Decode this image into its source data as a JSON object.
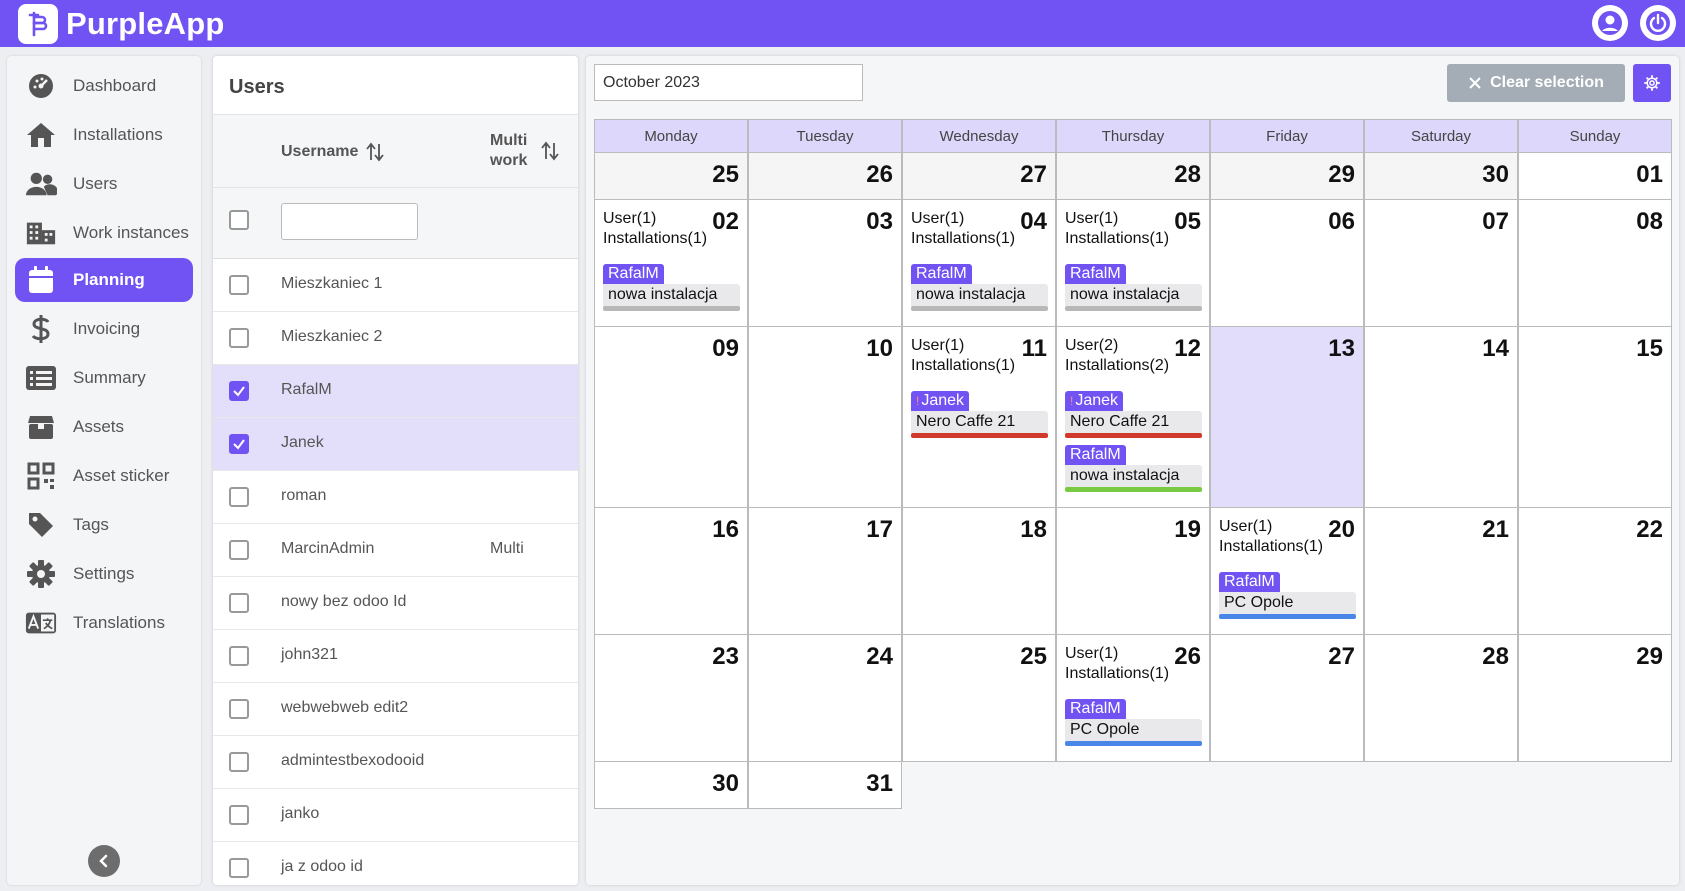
{
  "app": {
    "title": "PurpleApp"
  },
  "sidebar": {
    "items": [
      {
        "label": "Dashboard",
        "icon": "dashboard-gauge-icon",
        "active": false
      },
      {
        "label": "Installations",
        "icon": "home-icon",
        "active": false
      },
      {
        "label": "Users",
        "icon": "users-icon",
        "active": false
      },
      {
        "label": "Work instances",
        "icon": "buildings-icon",
        "active": false
      },
      {
        "label": "Planning",
        "icon": "calendar-icon",
        "active": true
      },
      {
        "label": "Invoicing",
        "icon": "dollar-icon",
        "active": false
      },
      {
        "label": "Summary",
        "icon": "list-icon",
        "active": false
      },
      {
        "label": "Assets",
        "icon": "box-icon",
        "active": false
      },
      {
        "label": "Asset sticker",
        "icon": "qr-code-icon",
        "active": false
      },
      {
        "label": "Tags",
        "icon": "tag-icon",
        "active": false
      },
      {
        "label": "Settings",
        "icon": "gear-icon",
        "active": false
      },
      {
        "label": "Translations",
        "icon": "translate-icon",
        "active": false
      }
    ]
  },
  "users_panel": {
    "title": "Users",
    "col_username": "Username",
    "col_multi_line1": "Multi",
    "col_multi_line2": "work",
    "filter_value": "",
    "rows": [
      {
        "username": "Mieszkaniec 1",
        "multi": "",
        "checked": false
      },
      {
        "username": "Mieszkaniec 2",
        "multi": "",
        "checked": false
      },
      {
        "username": "RafalM",
        "multi": "",
        "checked": true
      },
      {
        "username": "Janek",
        "multi": "",
        "checked": true
      },
      {
        "username": "roman",
        "multi": "",
        "checked": false
      },
      {
        "username": "MarcinAdmin",
        "multi": "Multi",
        "checked": false
      },
      {
        "username": "nowy bez odoo Id",
        "multi": "",
        "checked": false
      },
      {
        "username": "john321",
        "multi": "",
        "checked": false
      },
      {
        "username": "webwebweb edit2",
        "multi": "",
        "checked": false
      },
      {
        "username": "admintestbexodooid",
        "multi": "",
        "checked": false
      },
      {
        "username": "janko",
        "multi": "",
        "checked": false
      },
      {
        "username": "ja z odoo id",
        "multi": "",
        "checked": false
      }
    ]
  },
  "calendar": {
    "month_value": "October 2023",
    "clear_label": "Clear selection",
    "weekdays": [
      "Monday",
      "Tuesday",
      "Wednesday",
      "Thursday",
      "Friday",
      "Saturday",
      "Sunday"
    ],
    "weeks": [
      [
        {
          "day": "25",
          "other": true
        },
        {
          "day": "26",
          "other": true
        },
        {
          "day": "27",
          "other": true
        },
        {
          "day": "28",
          "other": true
        },
        {
          "day": "29",
          "other": true
        },
        {
          "day": "30",
          "other": true
        },
        {
          "day": "01"
        }
      ],
      [
        {
          "day": "02",
          "summary1": "User(1)",
          "summary2": "Installations(1)",
          "events": [
            {
              "user": "RafalM",
              "name": "nowa instalacja",
              "bar": "#b8b8b8",
              "flag": ""
            }
          ]
        },
        {
          "day": "03"
        },
        {
          "day": "04",
          "summary1": "User(1)",
          "summary2": "Installations(1)",
          "events": [
            {
              "user": "RafalM",
              "name": "nowa instalacja",
              "bar": "#b8b8b8",
              "flag": ""
            }
          ]
        },
        {
          "day": "05",
          "summary1": "User(1)",
          "summary2": "Installations(1)",
          "events": [
            {
              "user": "RafalM",
              "name": "nowa instalacja",
              "bar": "#b8b8b8",
              "flag": ""
            }
          ]
        },
        {
          "day": "06"
        },
        {
          "day": "07"
        },
        {
          "day": "08"
        }
      ],
      [
        {
          "day": "09"
        },
        {
          "day": "10"
        },
        {
          "day": "11",
          "summary1": "User(1)",
          "summary2": "Installations(1)",
          "events": [
            {
              "user": "Janek",
              "name": "Nero Caffe 21",
              "bar": "#d0392b",
              "flag": "!"
            }
          ]
        },
        {
          "day": "12",
          "summary1": "User(2)",
          "summary2": "Installations(2)",
          "events": [
            {
              "user": "Janek",
              "name": "Nero Caffe 21",
              "bar": "#d0392b",
              "flag": "!"
            },
            {
              "user": "RafalM",
              "name": "nowa instalacja",
              "bar": "#7ac943",
              "flag": ""
            }
          ]
        },
        {
          "day": "13",
          "today": true
        },
        {
          "day": "14"
        },
        {
          "day": "15"
        }
      ],
      [
        {
          "day": "16"
        },
        {
          "day": "17"
        },
        {
          "day": "18"
        },
        {
          "day": "19"
        },
        {
          "day": "20",
          "summary1": "User(1)",
          "summary2": "Installations(1)",
          "events": [
            {
              "user": "RafalM",
              "name": "PC Opole",
              "bar": "#4a86e8",
              "flag": ""
            }
          ]
        },
        {
          "day": "21"
        },
        {
          "day": "22"
        }
      ],
      [
        {
          "day": "23"
        },
        {
          "day": "24"
        },
        {
          "day": "25"
        },
        {
          "day": "26",
          "summary1": "User(1)",
          "summary2": "Installations(1)",
          "events": [
            {
              "user": "RafalM",
              "name": "PC Opole",
              "bar": "#4a86e8",
              "flag": ""
            }
          ]
        },
        {
          "day": "27"
        },
        {
          "day": "28"
        },
        {
          "day": "29"
        }
      ],
      [
        {
          "day": "30"
        },
        {
          "day": "31"
        }
      ]
    ]
  },
  "colors": {
    "accent": "#7152f3",
    "selected_row": "#e3dffb",
    "header_row": "#dcd7fb"
  }
}
